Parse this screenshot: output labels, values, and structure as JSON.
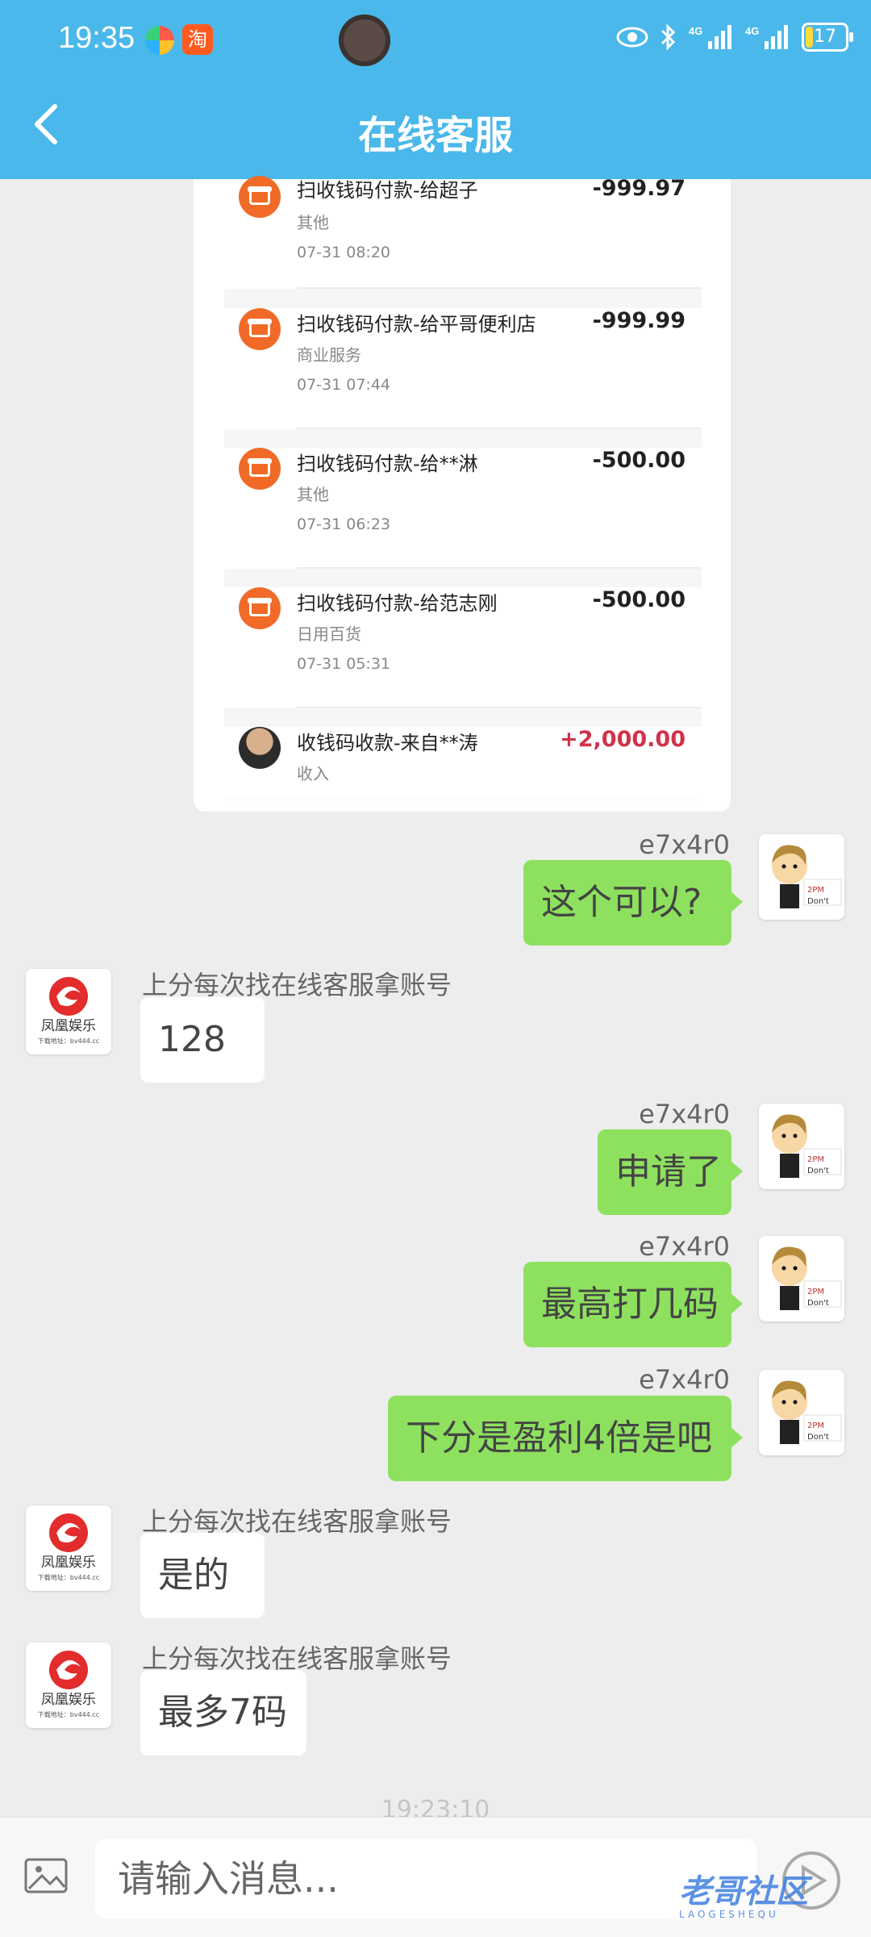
{
  "status_bar": {
    "time": "19:35",
    "app2_glyph": "淘",
    "battery": "17"
  },
  "header": {
    "title": "在线客服",
    "back_icon": "chevron-left-icon"
  },
  "transactions": [
    {
      "title": "扫收钱码付款-给超子",
      "category": "其他",
      "time": "07-31 08:20",
      "amount": "-999.97",
      "icon": "store-icon"
    },
    {
      "title": "扫收钱码付款-给平哥便利店",
      "category": "商业服务",
      "time": "07-31 07:44",
      "amount": "-999.99",
      "icon": "store-icon"
    },
    {
      "title": "扫收钱码付款-给**淋",
      "category": "其他",
      "time": "07-31 06:23",
      "amount": "-500.00",
      "icon": "store-icon"
    },
    {
      "title": "扫收钱码付款-给范志刚",
      "category": "日用百货",
      "time": "07-31 05:31",
      "amount": "-500.00",
      "icon": "store-icon"
    },
    {
      "title": "收钱码收款-来自**涛",
      "category": "收入",
      "time": "",
      "amount": "+2,000.00",
      "icon": "user-avatar"
    }
  ],
  "messages": [
    {
      "from": "me",
      "sender": "e7x4r0",
      "text": "这个可以?"
    },
    {
      "from": "cs",
      "sender": "上分每次找在线客服拿账号",
      "text": "128"
    },
    {
      "from": "me",
      "sender": "e7x4r0",
      "text": "申请了"
    },
    {
      "from": "me",
      "sender": "e7x4r0",
      "text": "最高打几码"
    },
    {
      "from": "me",
      "sender": "e7x4r0",
      "text": "下分是盈利4倍是吧"
    },
    {
      "from": "cs",
      "sender": "上分每次找在线客服拿账号",
      "text": "是的"
    },
    {
      "from": "cs",
      "sender": "上分每次找在线客服拿账号",
      "text": "最多7码"
    }
  ],
  "cs_avatar": {
    "name": "凤凰娱乐",
    "sub": "下载地址：bv444.cc"
  },
  "timestamp": "19:23:10",
  "input": {
    "placeholder": "请输入消息..."
  },
  "watermark": {
    "text": "老哥社区",
    "sub": "LAOGESHEQU"
  },
  "colors": {
    "header": "#4ab8ea",
    "my_bubble": "#8ee15f",
    "income": "#d0324a",
    "tx_icon": "#f16a28"
  }
}
